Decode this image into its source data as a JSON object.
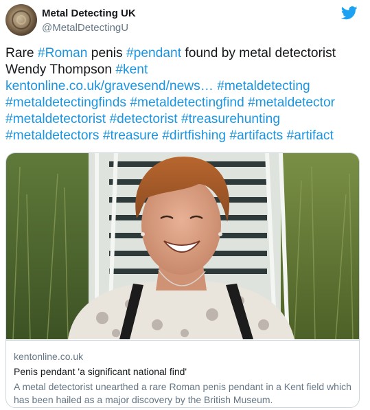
{
  "author": {
    "display_name": "Metal Detecting UK",
    "handle": "@MetalDetectingU"
  },
  "icons": {
    "avatar": "metal-coin-avatar",
    "platform": "twitter-bird-icon"
  },
  "colors": {
    "link": "#1b95e0",
    "twitter_blue": "#1da1f2",
    "muted": "#657786",
    "border": "#ccd6dd"
  },
  "tweet": {
    "t1": "Rare ",
    "h1": "#Roman",
    "t2": " penis ",
    "h2": "#pendant",
    "t3": " found by metal detectorist Wendy Thompson ",
    "h3": "#kent",
    "link": "kentonline.co.uk/gravesend/news…",
    "h4": "#metaldetecting",
    "h5": "#metaldetectingfinds",
    "h6": "#metaldetectingfind",
    "h7": "#metaldetector",
    "h8": "#metaldetectorist",
    "h9": "#detectorist",
    "h10": "#treasurehunting",
    "h11": "#metaldetectors",
    "h12": "#treasure",
    "h13": "#dirtfishing",
    "h14": "#artifacts",
    "h15": "#artifact"
  },
  "card": {
    "domain": "kentonline.co.uk",
    "title": "Penis pendant 'a significant national find'",
    "description": "A metal detectorist unearthed a rare Roman penis pendant in a Kent field which has been hailed as a major discovery by the British Museum."
  }
}
